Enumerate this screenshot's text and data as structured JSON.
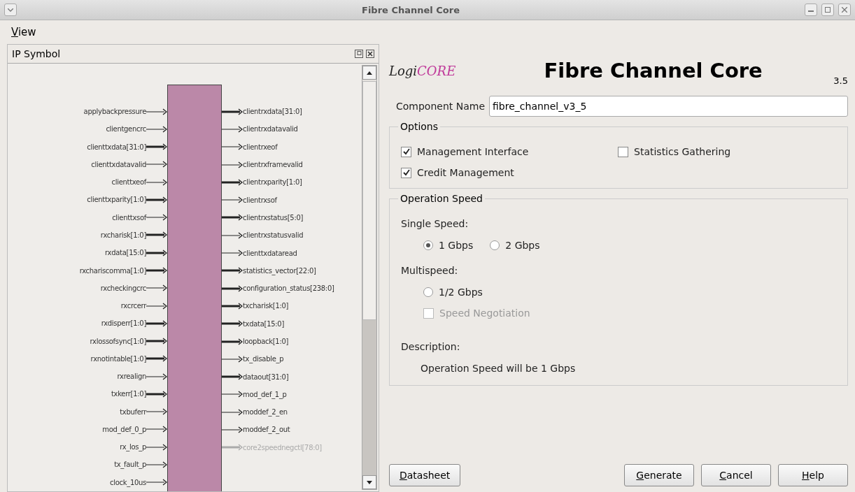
{
  "window": {
    "title": "Fibre Channel Core"
  },
  "menu": [
    "View"
  ],
  "symbol_panel": {
    "title": "IP Symbol",
    "left_pins": [
      {
        "name": "applybackpressure",
        "bus": false
      },
      {
        "name": "clientgencrc",
        "bus": false
      },
      {
        "name": "clienttxdata[31:0]",
        "bus": true
      },
      {
        "name": "clienttxdatavalid",
        "bus": false
      },
      {
        "name": "clienttxeof",
        "bus": false
      },
      {
        "name": "clienttxparity[1:0]",
        "bus": true
      },
      {
        "name": "clienttxsof",
        "bus": false
      },
      {
        "name": "rxcharisk[1:0]",
        "bus": true
      },
      {
        "name": "rxdata[15:0]",
        "bus": true
      },
      {
        "name": "rxchariscomma[1:0]",
        "bus": true
      },
      {
        "name": "rxcheckingcrc",
        "bus": false
      },
      {
        "name": "rxcrcerr",
        "bus": false
      },
      {
        "name": "rxdisperr[1:0]",
        "bus": true
      },
      {
        "name": "rxlossofsync[1:0]",
        "bus": true
      },
      {
        "name": "rxnotintable[1:0]",
        "bus": true
      },
      {
        "name": "rxrealign",
        "bus": false
      },
      {
        "name": "txkerr[1:0]",
        "bus": true
      },
      {
        "name": "txbuferr",
        "bus": false
      },
      {
        "name": "mod_def_0_p",
        "bus": false
      },
      {
        "name": "rx_los_p",
        "bus": false
      },
      {
        "name": "tx_fault_p",
        "bus": false
      },
      {
        "name": "clock_10us",
        "bus": false
      }
    ],
    "right_pins": [
      {
        "name": "clientrxdata[31:0]",
        "bus": true,
        "disabled": false
      },
      {
        "name": "clientrxdatavalid",
        "bus": false,
        "disabled": false
      },
      {
        "name": "clientrxeof",
        "bus": false,
        "disabled": false
      },
      {
        "name": "clientrxframevalid",
        "bus": false,
        "disabled": false
      },
      {
        "name": "clientrxparity[1:0]",
        "bus": true,
        "disabled": false
      },
      {
        "name": "clientrxsof",
        "bus": false,
        "disabled": false
      },
      {
        "name": "clientrxstatus[5:0]",
        "bus": true,
        "disabled": false
      },
      {
        "name": "clientrxstatusvalid",
        "bus": false,
        "disabled": false
      },
      {
        "name": "clienttxdataread",
        "bus": false,
        "disabled": false
      },
      {
        "name": "statistics_vector[22:0]",
        "bus": true,
        "disabled": false
      },
      {
        "name": "configuration_status[238:0]",
        "bus": true,
        "disabled": false
      },
      {
        "name": "txcharisk[1:0]",
        "bus": true,
        "disabled": false
      },
      {
        "name": "txdata[15:0]",
        "bus": true,
        "disabled": false
      },
      {
        "name": "loopback[1:0]",
        "bus": true,
        "disabled": false
      },
      {
        "name": "tx_disable_p",
        "bus": false,
        "disabled": false
      },
      {
        "name": "dataout[31:0]",
        "bus": true,
        "disabled": false
      },
      {
        "name": "mod_def_1_p",
        "bus": false,
        "disabled": false
      },
      {
        "name": "moddef_2_en",
        "bus": false,
        "disabled": false
      },
      {
        "name": "moddef_2_out",
        "bus": false,
        "disabled": false
      },
      {
        "name": "core2speednegctl[78:0]",
        "bus": true,
        "disabled": true
      }
    ]
  },
  "header": {
    "logo_parts": [
      "Logi",
      "CORE"
    ],
    "title": "Fibre Channel Core",
    "version": "3.5"
  },
  "component_name": {
    "label": "Component Name",
    "value": "fibre_channel_v3_5"
  },
  "options": {
    "title": "Options",
    "items": [
      {
        "label": "Management Interface",
        "checked": true
      },
      {
        "label": "Statistics Gathering",
        "checked": false
      },
      {
        "label": "Credit Management",
        "checked": true
      }
    ]
  },
  "operation_speed": {
    "title": "Operation Speed",
    "single_label": "Single Speed:",
    "single_options": [
      {
        "label": "1 Gbps",
        "selected": true
      },
      {
        "label": "2 Gbps",
        "selected": false
      }
    ],
    "multi_label": "Multispeed:",
    "multi_options": [
      {
        "label": "1/2 Gbps",
        "selected": false
      }
    ],
    "negotiation": {
      "label": "Speed Negotiation",
      "checked": false,
      "disabled": true
    },
    "description_label": "Description:",
    "description": "Operation Speed will be 1 Gbps"
  },
  "buttons_left": [
    "Datasheet"
  ],
  "buttons_right": [
    "Generate",
    "Cancel",
    "Help"
  ]
}
